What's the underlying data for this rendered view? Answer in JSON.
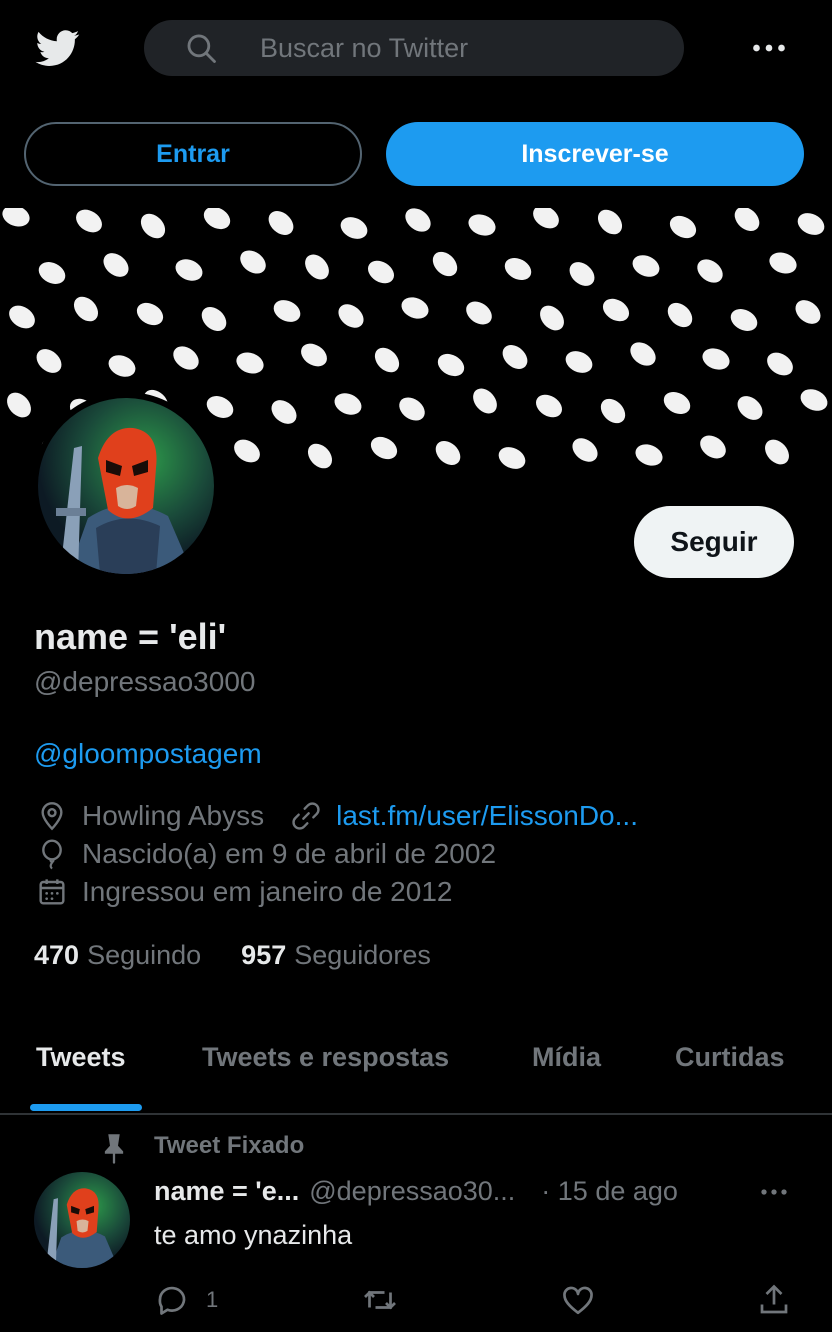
{
  "topbar": {
    "logo_icon": "twitter-bird-icon",
    "search_placeholder": "Buscar no Twitter",
    "more_icon": "more-dots-icon"
  },
  "auth": {
    "login_label": "Entrar",
    "signup_label": "Inscrever-se"
  },
  "profile": {
    "display_name": "name = 'eli'",
    "handle": "@depressao3000",
    "bio_mention": "@gloompostagem",
    "location": "Howling Abyss",
    "website": "last.fm/user/ElissonDo...",
    "birthday": "Nascido(a) em 9 de abril de 2002",
    "joined": "Ingressou em janeiro de 2012",
    "following_count": "470",
    "following_label": "Seguindo",
    "followers_count": "957",
    "followers_label": "Seguidores",
    "follow_label": "Seguir"
  },
  "tabs": [
    {
      "label": "Tweets",
      "active": true
    },
    {
      "label": "Tweets e respostas",
      "active": false
    },
    {
      "label": "Mídia",
      "active": false
    },
    {
      "label": "Curtidas",
      "active": false
    }
  ],
  "tweet": {
    "pinned_label": "Tweet Fixado",
    "name": "name = 'e...",
    "handle": "@depressao30...",
    "time": "· 15 de ago",
    "text": "te amo ynazinha",
    "reply_count": "1"
  },
  "colors": {
    "accent": "#1d9bf0",
    "background": "#000000",
    "muted": "#71767b",
    "text": "#e7e9ea"
  }
}
